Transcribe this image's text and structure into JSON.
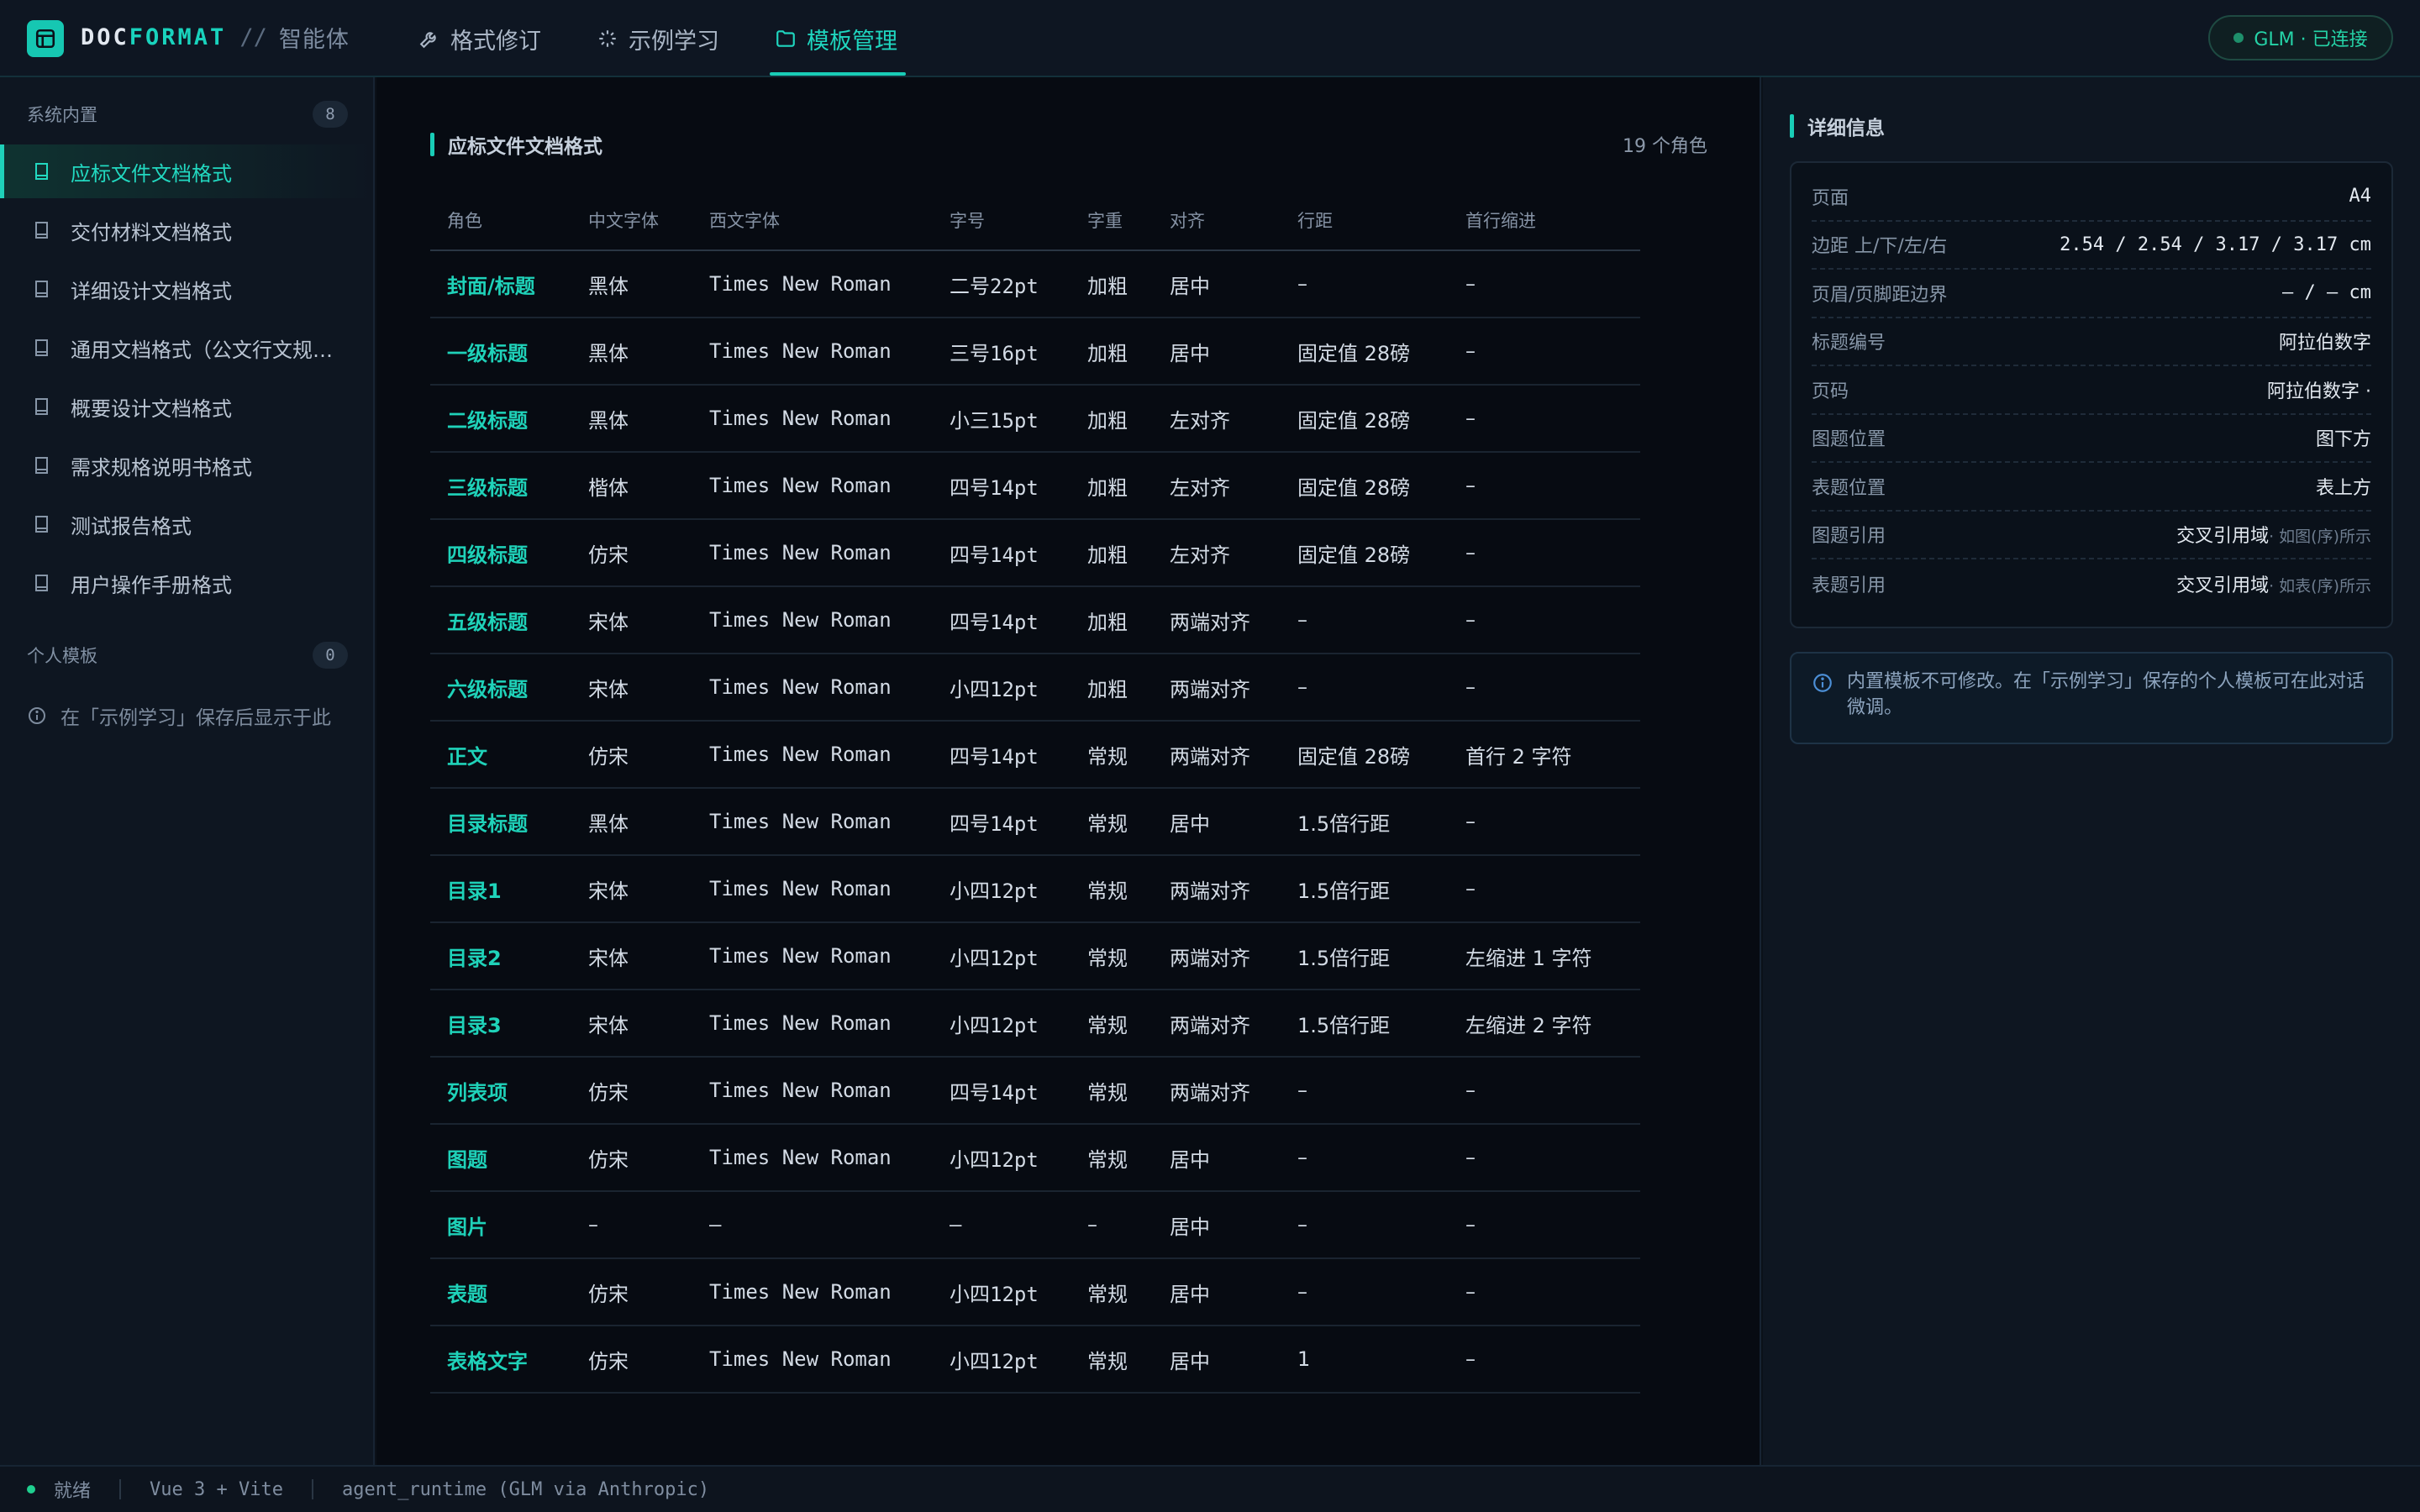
{
  "app": {
    "brand_a": "DOC",
    "brand_b": "FORMAT",
    "separator": "//",
    "subtitle": "智能体"
  },
  "nav": {
    "tabs": [
      {
        "label": "格式修订",
        "icon": "wrench-icon"
      },
      {
        "label": "示例学习",
        "icon": "sparkle-icon"
      },
      {
        "label": "模板管理",
        "icon": "folder-icon"
      }
    ],
    "active": "模板管理"
  },
  "connection": {
    "label": "GLM · 已连接",
    "color": "#25d3a7"
  },
  "sidebar": {
    "builtin": {
      "title": "系统内置",
      "count": "8",
      "items": [
        {
          "label": "应标文件文档格式"
        },
        {
          "label": "交付材料文档格式"
        },
        {
          "label": "详细设计文档格式"
        },
        {
          "label": "通用文档格式（公文行文规范）"
        },
        {
          "label": "概要设计文档格式"
        },
        {
          "label": "需求规格说明书格式"
        },
        {
          "label": "测试报告格式"
        },
        {
          "label": "用户操作手册格式"
        }
      ]
    },
    "personal": {
      "title": "个人模板",
      "count": "0",
      "hint": "在「示例学习」保存后显示于此"
    }
  },
  "main": {
    "title": "应标文件文档格式",
    "role_count": "19 个角色",
    "columns": [
      "角色",
      "中文字体",
      "西文字体",
      "字号",
      "字重",
      "对齐",
      "行距",
      "首行缩进"
    ],
    "rows": [
      [
        "封面/标题",
        "黑体",
        "Times New Roman",
        "二号22pt",
        "加粗",
        "居中",
        "–",
        "–"
      ],
      [
        "一级标题",
        "黑体",
        "Times New Roman",
        "三号16pt",
        "加粗",
        "居中",
        "固定值 28磅",
        "–"
      ],
      [
        "二级标题",
        "黑体",
        "Times New Roman",
        "小三15pt",
        "加粗",
        "左对齐",
        "固定值 28磅",
        "–"
      ],
      [
        "三级标题",
        "楷体",
        "Times New Roman",
        "四号14pt",
        "加粗",
        "左对齐",
        "固定值 28磅",
        "–"
      ],
      [
        "四级标题",
        "仿宋",
        "Times New Roman",
        "四号14pt",
        "加粗",
        "左对齐",
        "固定值 28磅",
        "–"
      ],
      [
        "五级标题",
        "宋体",
        "Times New Roman",
        "四号14pt",
        "加粗",
        "两端对齐",
        "–",
        "–"
      ],
      [
        "六级标题",
        "宋体",
        "Times New Roman",
        "小四12pt",
        "加粗",
        "两端对齐",
        "–",
        "–"
      ],
      [
        "正文",
        "仿宋",
        "Times New Roman",
        "四号14pt",
        "常规",
        "两端对齐",
        "固定值 28磅",
        "首行 2 字符"
      ],
      [
        "目录标题",
        "黑体",
        "Times New Roman",
        "四号14pt",
        "常规",
        "居中",
        "1.5倍行距",
        "–"
      ],
      [
        "目录1",
        "宋体",
        "Times New Roman",
        "小四12pt",
        "常规",
        "两端对齐",
        "1.5倍行距",
        "–"
      ],
      [
        "目录2",
        "宋体",
        "Times New Roman",
        "小四12pt",
        "常规",
        "两端对齐",
        "1.5倍行距",
        "左缩进 1 字符"
      ],
      [
        "目录3",
        "宋体",
        "Times New Roman",
        "小四12pt",
        "常规",
        "两端对齐",
        "1.5倍行距",
        "左缩进 2 字符"
      ],
      [
        "列表项",
        "仿宋",
        "Times New Roman",
        "四号14pt",
        "常规",
        "两端对齐",
        "–",
        "–"
      ],
      [
        "图题",
        "仿宋",
        "Times New Roman",
        "小四12pt",
        "常规",
        "居中",
        "–",
        "–"
      ],
      [
        "图片",
        "–",
        "–",
        "–",
        "–",
        "居中",
        "–",
        "–"
      ],
      [
        "表题",
        "仿宋",
        "Times New Roman",
        "小四12pt",
        "常规",
        "居中",
        "–",
        "–"
      ],
      [
        "表格文字",
        "仿宋",
        "Times New Roman",
        "小四12pt",
        "常规",
        "居中",
        "1",
        "–"
      ]
    ]
  },
  "details": {
    "title": "详细信息",
    "rows": [
      {
        "key": "页面",
        "value": "A4"
      },
      {
        "key": "边距 上/下/左/右",
        "value": "2.54 / 2.54 / 3.17 / 3.17 cm"
      },
      {
        "key": "页眉/页脚距边界",
        "value": "– / – cm"
      },
      {
        "key": "标题编号",
        "value": "阿拉伯数字",
        "cn": true
      },
      {
        "key": "页码",
        "value": "阿拉伯数字 ·",
        "cn": true
      },
      {
        "key": "图题位置",
        "value": "图下方",
        "cn": true
      },
      {
        "key": "表题位置",
        "value": "表上方",
        "cn": true
      },
      {
        "key": "图题引用",
        "value": "交叉引用域",
        "sub": "· 如图(序)所示",
        "cn": true
      },
      {
        "key": "表题引用",
        "value": "交叉引用域",
        "sub": "· 如表(序)所示",
        "cn": true
      }
    ],
    "note": "内置模板不可修改。在「示例学习」保存的个人模板可在此对话微调。"
  },
  "statusbar": {
    "state": "就绪",
    "stack": "Vue 3 + Vite",
    "runtime": "agent_runtime (GLM via Anthropic)"
  },
  "colors": {
    "accent": "#19cdb7",
    "background": "#070b12",
    "panel": "#0e1621"
  }
}
